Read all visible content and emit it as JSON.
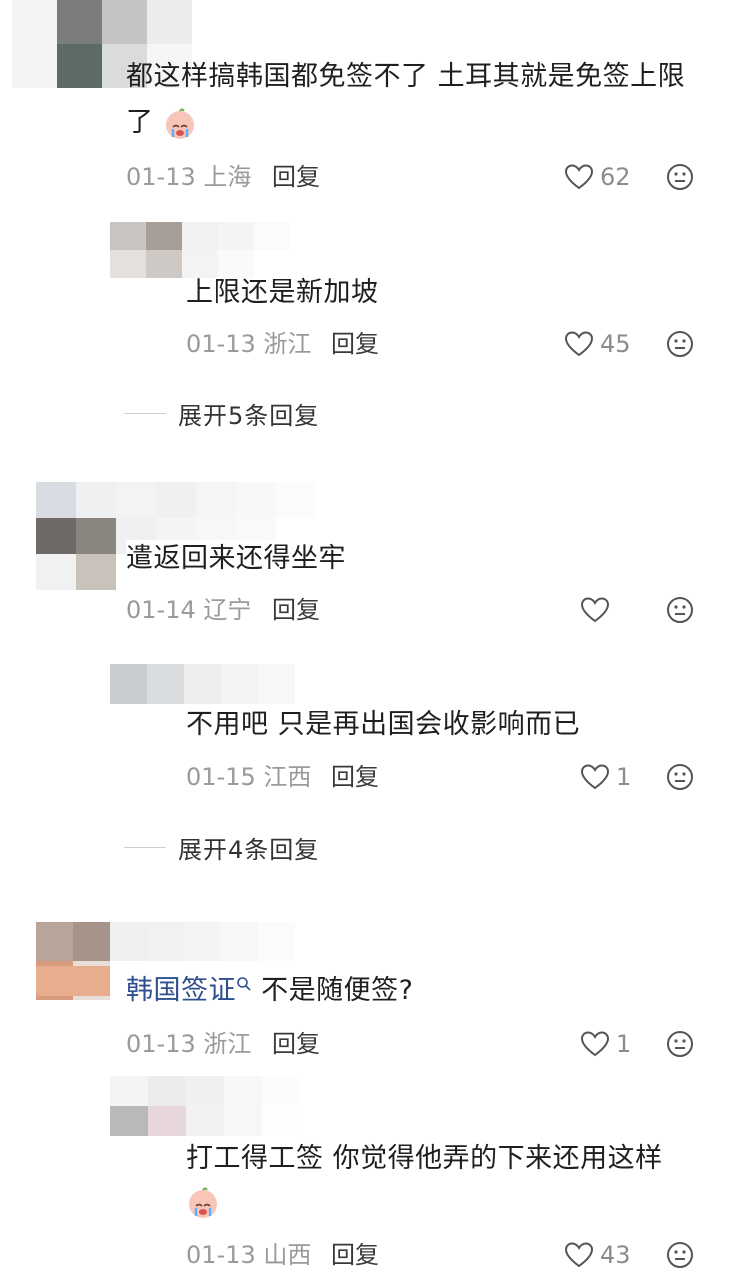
{
  "comments": [
    {
      "text": "都这样搞韩国都免签不了 土耳其就是免签上限",
      "text2": "了",
      "date": "01-13",
      "location": "上海",
      "reply_label": "回复",
      "likes": "62"
    },
    {
      "text": "上限还是新加坡",
      "date": "01-13",
      "location": "浙江",
      "reply_label": "回复",
      "likes": "45"
    },
    {
      "text": "遣返回来还得坐牢",
      "date": "01-14",
      "location": "辽宁",
      "reply_label": "回复",
      "likes": ""
    },
    {
      "text": "不用吧 只是再出国会收影响而已",
      "date": "01-15",
      "location": "江西",
      "reply_label": "回复",
      "likes": "1"
    },
    {
      "link": "韩国签证",
      "text": " 不是随便签?",
      "date": "01-13",
      "location": "浙江",
      "reply_label": "回复",
      "likes": "1"
    },
    {
      "text": "打工得工签 你觉得他弄的下来还用这样",
      "date": "01-13",
      "location": "山西",
      "reply_label": "回复",
      "likes": "43"
    }
  ],
  "expand": [
    "展开5条回复",
    "展开4条回复"
  ]
}
